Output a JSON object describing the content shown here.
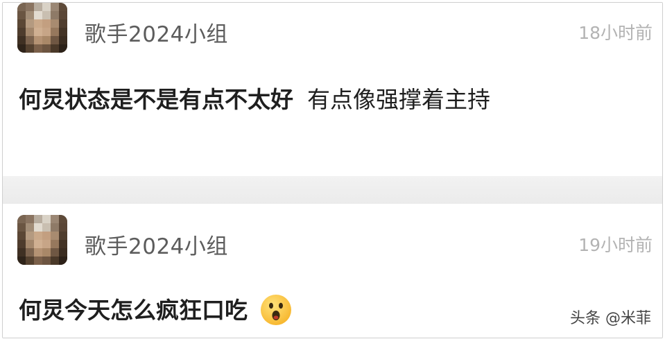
{
  "posts": [
    {
      "username": "歌手2024小组",
      "time": "18小时前",
      "content_main": "何炅状态是不是有点不太好",
      "content_extra": "有点像强撑着主持"
    },
    {
      "username": "歌手2024小组",
      "time": "19小时前",
      "content_main": "何炅今天怎么疯狂口吃",
      "emoji": "astonished-face"
    }
  ],
  "watermark": "头条 @米菲",
  "colors": {
    "username": "#5c5c5c",
    "timestamp": "#b3b3b3",
    "content": "#1f1f1f",
    "separator": "#eeeeee"
  }
}
